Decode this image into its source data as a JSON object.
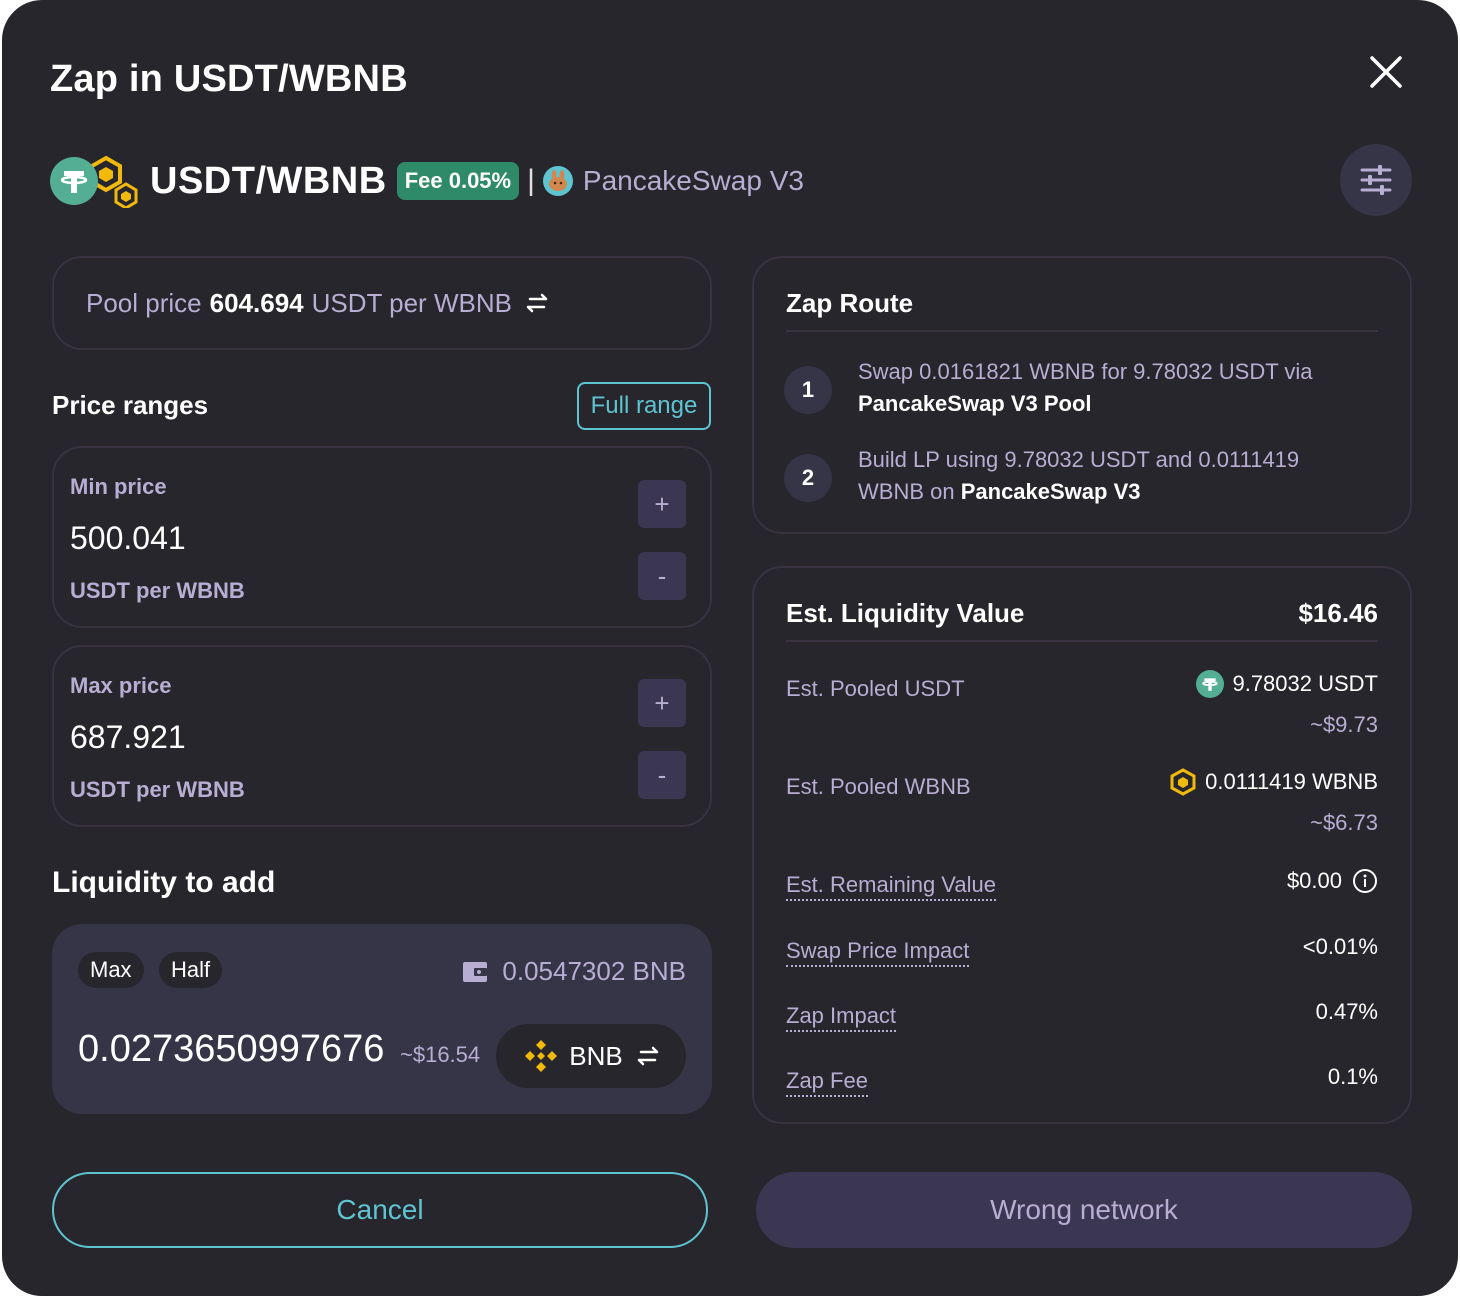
{
  "modal": {
    "title": "Zap in USDT/WBNB",
    "close_icon": "close-icon"
  },
  "pair": {
    "name": "USDT/WBNB",
    "fee_badge": "Fee 0.05%",
    "separator": "|",
    "protocol": "PancakeSwap V3",
    "settings_icon": "sliders-icon"
  },
  "pool_price": {
    "label": "Pool price",
    "value": "604.694",
    "unit": "USDT per WBNB"
  },
  "price_ranges": {
    "label": "Price ranges",
    "full_range_label": "Full range",
    "min": {
      "label": "Min price",
      "value": "500.041",
      "unit": "USDT per WBNB",
      "plus": "+",
      "minus": "-"
    },
    "max": {
      "label": "Max price",
      "value": "687.921",
      "unit": "USDT per WBNB",
      "plus": "+",
      "minus": "-"
    }
  },
  "liquidity": {
    "label": "Liquidity to add",
    "max_label": "Max",
    "half_label": "Half",
    "balance": "0.0547302 BNB",
    "amount": "0.0273650997676",
    "usd_approx": "~$16.54",
    "token": "BNB"
  },
  "zap_route": {
    "title": "Zap Route",
    "steps": [
      {
        "num": "1",
        "text": "Swap 0.0161821 WBNB for 9.78032 USDT via",
        "bold": "PancakeSwap V3 Pool"
      },
      {
        "num": "2",
        "text": "Build LP using 9.78032 USDT and 0.0111419 WBNB on",
        "bold": "PancakeSwap V3"
      }
    ]
  },
  "est_value": {
    "title": "Est. Liquidity Value",
    "total": "$16.46",
    "pooled_usdt": {
      "label": "Est. Pooled USDT",
      "amount": "9.78032 USDT",
      "usd": "~$9.73"
    },
    "pooled_wbnb": {
      "label": "Est. Pooled WBNB",
      "amount": "0.0111419 WBNB",
      "usd": "~$6.73"
    },
    "remaining": {
      "label": "Est. Remaining Value",
      "value": "$0.00"
    },
    "swap_impact": {
      "label": "Swap Price Impact",
      "value": "<0.01%"
    },
    "zap_impact": {
      "label": "Zap Impact",
      "value": "0.47%"
    },
    "zap_fee": {
      "label": "Zap Fee",
      "value": "0.1%"
    }
  },
  "footer": {
    "cancel_label": "Cancel",
    "network_label": "Wrong network"
  },
  "colors": {
    "background": "#27262c",
    "accent": "#5fc4d2",
    "muted": "#b8add2",
    "usdt": "#53ae94",
    "bnb": "#f0b90b"
  }
}
